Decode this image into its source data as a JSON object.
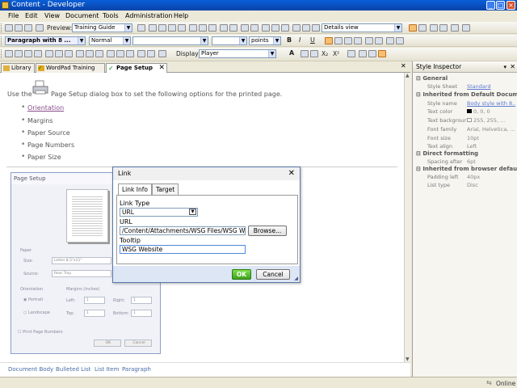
{
  "window": {
    "title": "Content - Developer"
  },
  "menu": [
    "File",
    "Edit",
    "View",
    "Document",
    "Tools",
    "Administration",
    "Help"
  ],
  "toolbar1": {
    "preview_label": "Preview:",
    "preview_value": "Training Guide",
    "view_value": "Details view"
  },
  "toolbar2": {
    "style_value": "Paragraph with 8 ...",
    "font_value": "Normal",
    "size_unit": "points"
  },
  "toolbar3": {
    "display_label": "Display:",
    "display_value": "Player"
  },
  "tabs": [
    {
      "label": "Library"
    },
    {
      "label": "WordPad Training"
    },
    {
      "label": "Page Setup"
    }
  ],
  "content": {
    "intro": "Use the",
    "intro_rest": "Page Setup dialog box to set the following options for the printed page.",
    "items": [
      "Orientation",
      "Margins",
      "Paper Source",
      "Page Numbers",
      "Paper Size"
    ]
  },
  "thumbnail": {
    "title": "Page Setup",
    "paper": "Paper",
    "size_label": "Size:",
    "size_value": "Letter 8.5\"x11\"",
    "source_label": "Source:",
    "source_value": "Rear Tray",
    "orientation": "Orientation",
    "portrait": "Portrait",
    "landscape": "Landscape",
    "margins": "Margins (inches)",
    "left": "Left:",
    "right": "Right:",
    "top": "Top:",
    "bottom": "Bottom:",
    "left_val": "1",
    "right_val": "1",
    "top_val": "1",
    "bottom_val": "1",
    "print_numbers": "Print Page Numbers",
    "ok": "OK",
    "cancel": "Cancel"
  },
  "dialog": {
    "title": "Link",
    "tab_link": "Link Info",
    "tab_target": "Target",
    "link_type_label": "Link Type",
    "link_type_value": "URL",
    "url_label": "URL",
    "url_value": "/Content/Attachments/WSG Files/WSG Webs",
    "browse": "Browse...",
    "tooltip_label": "Tooltip",
    "tooltip_value": "WSG Website",
    "ok": "OK",
    "cancel": "Cancel"
  },
  "breadcrumb": [
    "Document Body",
    "Bulleted List",
    "List Item",
    "Paragraph"
  ],
  "inspector": {
    "title": "Style Inspector",
    "general": "General",
    "style_sheet_k": "Style Sheet",
    "style_sheet_v": "Standard",
    "inherited_default": "Inherited from Default Document",
    "style_name_k": "Style name",
    "style_name_v": "Body style with 8...",
    "text_color_k": "Text color",
    "text_color_v": "0, 0, 0",
    "text_bg_k": "Text backgrour",
    "text_bg_v": "255, 255, ...",
    "font_family_k": "Font family",
    "font_family_v": "Arial, Helvetica, ...",
    "font_size_k": "Font size",
    "font_size_v": "10pt",
    "text_align_k": "Text align",
    "text_align_v": "Left",
    "direct": "Direct formatting",
    "spacing_after_k": "Spacing after",
    "spacing_after_v": "6pt",
    "inherited_browser": "Inherited from browser defaults",
    "padding_left_k": "Padding left",
    "padding_left_v": "40px",
    "list_type_k": "List type",
    "list_type_v": "Disc"
  },
  "status": {
    "online": "Online"
  }
}
